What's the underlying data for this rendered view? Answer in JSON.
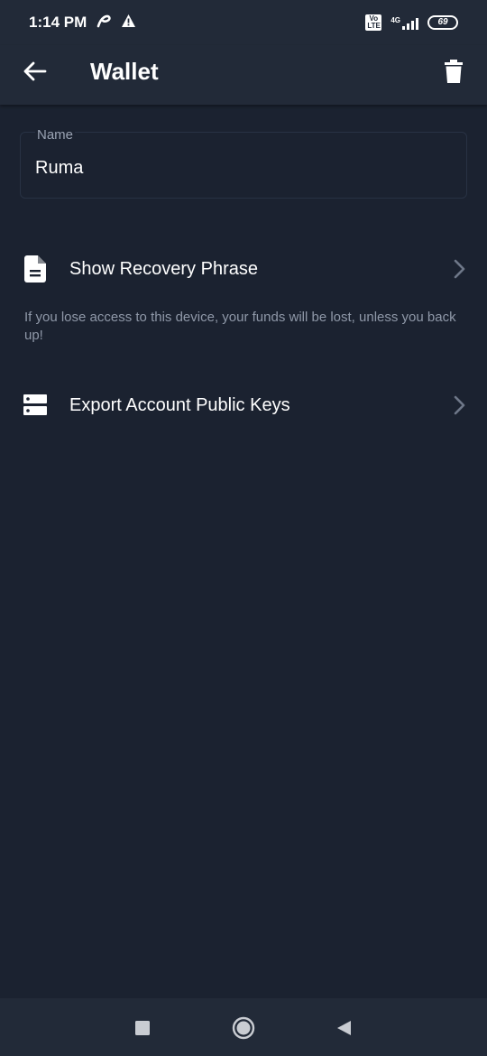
{
  "status_bar": {
    "time": "1:14 PM",
    "volte": "Vo LTE",
    "network": "4G",
    "battery": "69"
  },
  "app_bar": {
    "title": "Wallet",
    "back_icon": "arrow-left-icon",
    "delete_icon": "trash-icon"
  },
  "name_field": {
    "label": "Name",
    "value": "Ruma"
  },
  "menu": [
    {
      "label": "Show Recovery Phrase",
      "icon": "document-icon"
    },
    {
      "label": "Export Account Public Keys",
      "icon": "server-icon"
    }
  ],
  "hint": "If you lose access to this device, your funds will be lost, unless you back up!",
  "colors": {
    "background": "#1b2230",
    "app_bar": "#222a38",
    "text": "#ffffff",
    "hint_text": "#8f98a8"
  }
}
